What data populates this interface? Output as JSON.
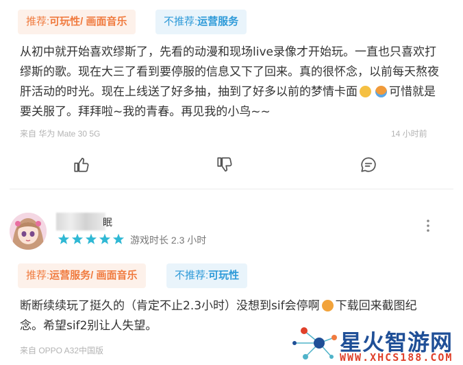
{
  "review1": {
    "recommend_label": "推荐:",
    "recommend_value": "可玩性/ 画面音乐",
    "not_recommend_label": "不推荐:",
    "not_recommend_value": "运营服务",
    "text_part1": "从初中就开始喜欢缪斯了，先看的动漫和现场live录像才开始玩。一直也只喜欢打缪斯的歌。现在大三了看到要停服的信息又下了回来。真的很怀念，以前每天熬夜肝活动的时光。现在上线送了好多抽，抽到了好多以前的梦情卡面",
    "text_part2": "可惜就是要关服了。拜拜啦~我的青春。再见我的小鸟~~",
    "device": "来自 华为 Mate 30 5G",
    "time": "14 小时前",
    "emoji1": "pensive-face",
    "emoji2": "crying-face"
  },
  "actions": {
    "like_icon": "thumbs-up-icon",
    "dislike_icon": "thumbs-down-icon",
    "comment_icon": "comment-icon"
  },
  "review2": {
    "username_visible": "眠",
    "rating_stars": 5,
    "playtime": "游戏时长 2.3 小时",
    "recommend_label": "推荐:",
    "recommend_value": "运营服务/ 画面音乐",
    "not_recommend_label": "不推荐:",
    "not_recommend_value": "可玩性",
    "text_part1": "断断续续玩了挺久的（肯定不止2.3小时）没想到sif会停啊",
    "text_part2": "下载回来截图纪念。希望sif2别让人失望。",
    "device": "来自 OPPO A32中国版",
    "emoji1": "worried-face"
  },
  "watermark": {
    "title": "星火智游网",
    "url": "WWW.XHCS188.COM"
  },
  "colors": {
    "recommend_bg": "#fdf1ea",
    "recommend_text": "#f07b3f",
    "not_recommend_bg": "#e9f4fb",
    "not_recommend_text": "#2e9ad8",
    "star": "#2fb8d4"
  }
}
